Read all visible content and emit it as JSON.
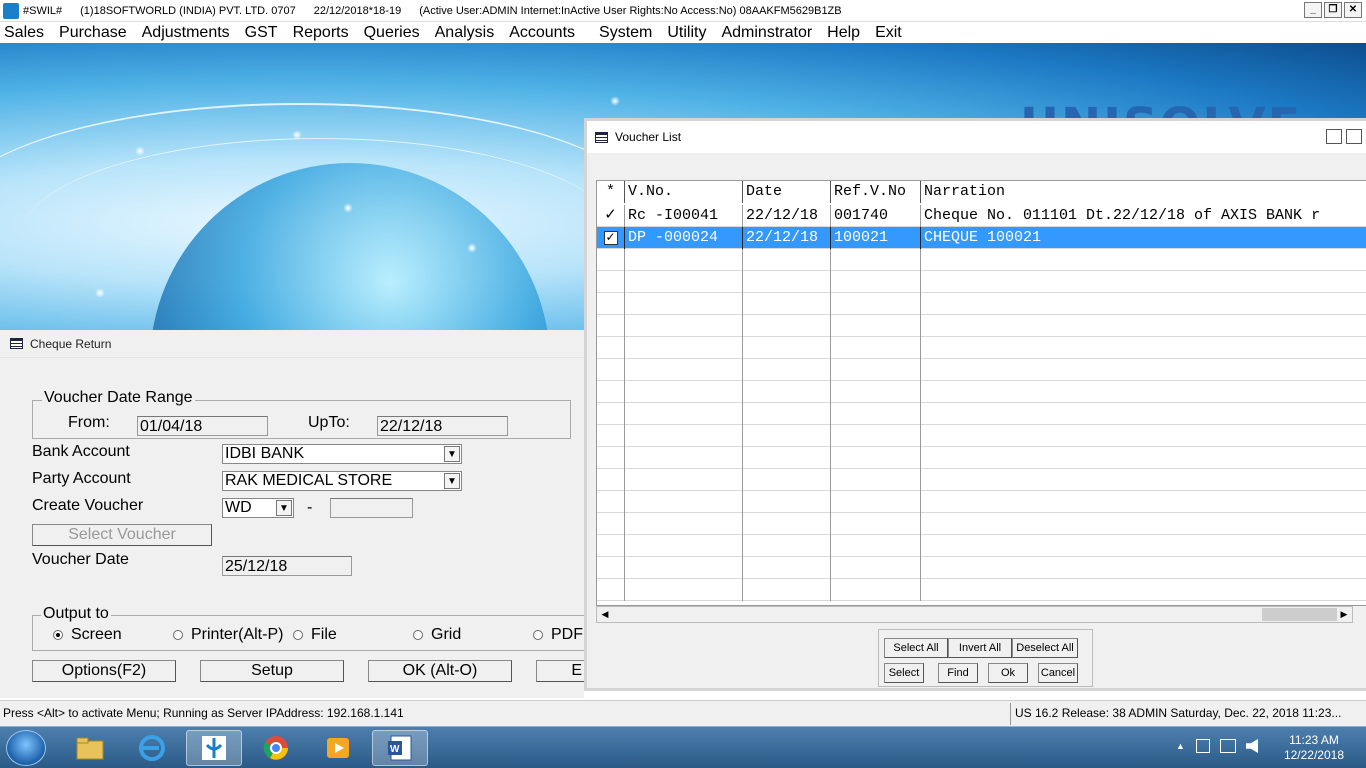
{
  "titlebar": {
    "app": "#SWIL#",
    "company": "(1)18SOFTWORLD (INDIA) PVT. LTD. 0707",
    "date_range": "22/12/2018*18-19",
    "status": "(Active User:ADMIN Internet:InActive User Rights:No Access:No) 08AAKFM5629B1ZB"
  },
  "menu": [
    "Sales",
    "Purchase",
    "Adjustments",
    "GST",
    "Reports",
    "Queries",
    "Analysis",
    "Accounts",
    "System",
    "Utility",
    "Adminstrator",
    "Help",
    "Exit"
  ],
  "banner_logo": "UNISOLVE",
  "cheque_return": {
    "title": "Cheque Return",
    "date_range_legend": "Voucher Date Range",
    "from_label": "From:",
    "from_value": "01/04/18",
    "upto_label": "UpTo:",
    "upto_value": "22/12/18",
    "bank_label": "Bank Account",
    "bank_value": "IDBI BANK",
    "party_label": "Party Account",
    "party_value": "RAK MEDICAL STORE",
    "create_label": "Create Voucher",
    "create_value": "WD",
    "dash": "-",
    "select_voucher": "Select Voucher",
    "vdate_label": "Voucher Date",
    "vdate_value": "25/12/18",
    "output_legend": "Output to",
    "outputs": [
      "Screen",
      "Printer(Alt-P)",
      "File",
      "Grid",
      "PDF"
    ],
    "options_btn": "Options(F2)",
    "setup_btn": "Setup",
    "ok_btn": "OK (Alt-O)",
    "exit_btn": "E"
  },
  "voucher_list": {
    "title": "Voucher List",
    "columns": [
      "*",
      "V.No.",
      "Date",
      "Ref.V.No",
      "Narration"
    ],
    "rows": [
      {
        "mark": "✓",
        "vno": "Rc -I00041",
        "date": "22/12/18",
        "ref": "001740",
        "narration": "Cheque No. 011101 Dt.22/12/18 of AXIS BANK r"
      },
      {
        "mark": "✓",
        "vno": "DP -000024",
        "date": "22/12/18",
        "ref": "100021",
        "narration": "CHEQUE 100021"
      }
    ],
    "buttons": [
      "Select All",
      "Invert All",
      "Deselect All",
      "Select",
      "Find",
      "Ok",
      "Cancel"
    ]
  },
  "status": {
    "left": "Press <Alt> to activate Menu; Running as Server IPAddress: 192.168.1.141",
    "right": "US 16.2 Release: 38  ADMIN  Saturday, Dec. 22, 2018  11:23..."
  },
  "taskbar": {
    "time": "11:23 AM",
    "date": "12/22/2018"
  }
}
